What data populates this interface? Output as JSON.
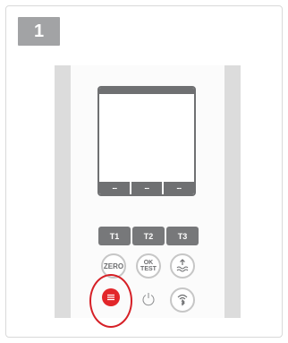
{
  "step": {
    "number": "1"
  },
  "display": {
    "softkeys": [
      "--",
      "--",
      "--"
    ]
  },
  "buttons": {
    "t1": "T1",
    "t2": "T2",
    "t3": "T3",
    "zero": "ZERO",
    "ok_line1": "OK",
    "ok_line2": "TEST"
  },
  "icons": {
    "waves": "waves-up-icon",
    "bluetooth": "bluetooth-remote-icon",
    "menu": "menu-icon",
    "power": "power-icon"
  },
  "colors": {
    "accent": "#e2262a",
    "badge": "#a2a3a5",
    "button": "#77787a"
  }
}
